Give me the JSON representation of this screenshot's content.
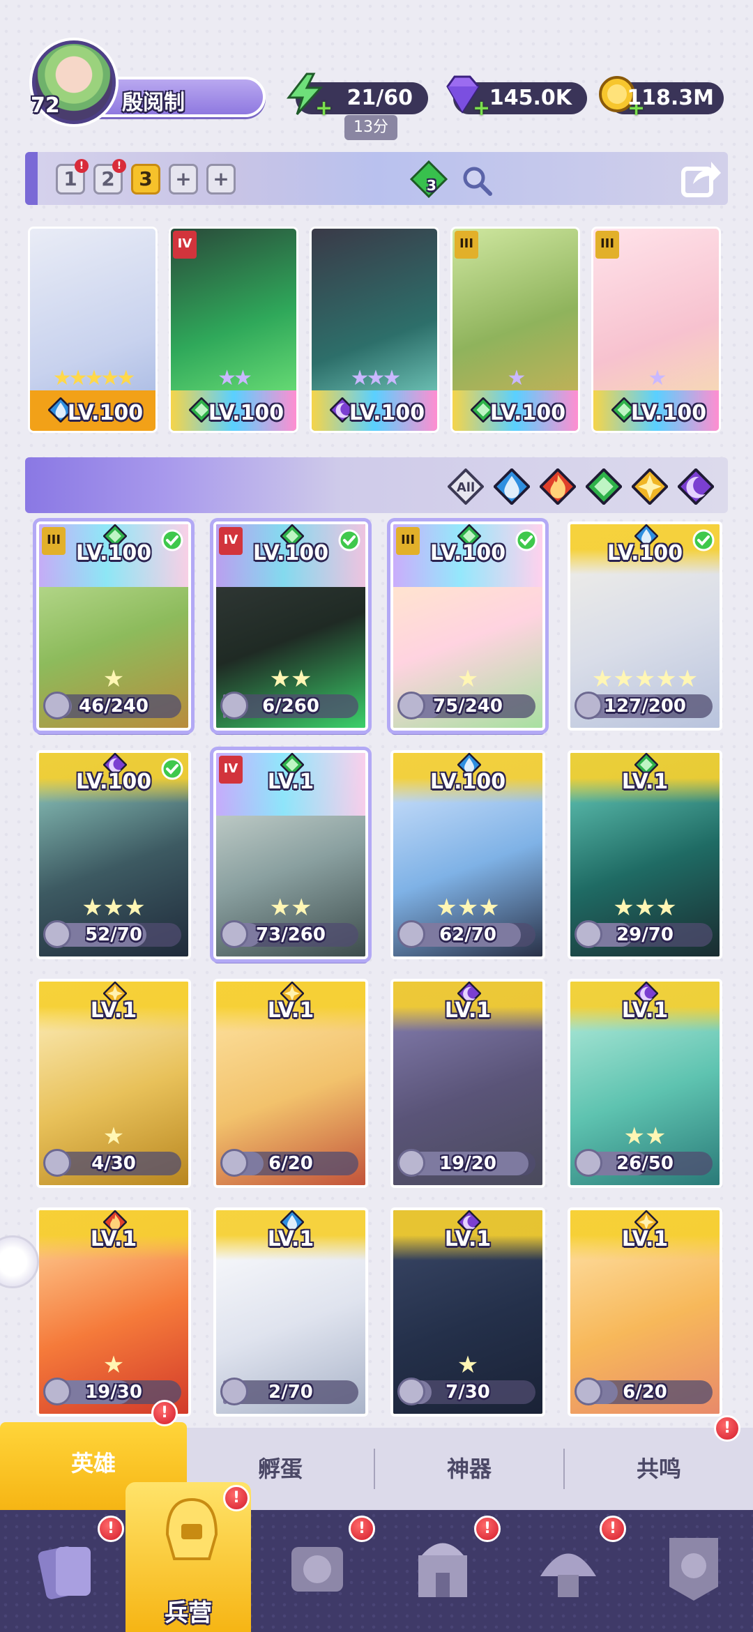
{
  "player": {
    "level": "72",
    "name": "殷阅制"
  },
  "resources": {
    "energy": {
      "value": "21/60",
      "timer": "13分",
      "icon": "lightning-bolt-icon"
    },
    "gems": {
      "value": "145.0K",
      "icon": "purple-gem-icon"
    },
    "gold": {
      "value": "118.3M",
      "icon": "gold-coin-icon"
    }
  },
  "team_bar": {
    "slots": [
      "1",
      "2",
      "3",
      "+",
      "+"
    ],
    "active_slot": "3",
    "gem_badge": "3"
  },
  "team": [
    {
      "level": "LV.100",
      "stars": "★★★★★",
      "element": "water",
      "rank": ""
    },
    {
      "level": "LV.100",
      "stars": "★★",
      "element": "nature",
      "rank": "IV"
    },
    {
      "level": "LV.100",
      "stars": "★★★",
      "element": "dark",
      "rank": ""
    },
    {
      "level": "LV.100",
      "stars": "★",
      "element": "nature",
      "rank": "III"
    },
    {
      "level": "LV.100",
      "stars": "★",
      "element": "nature",
      "rank": "III"
    }
  ],
  "filters": {
    "all_label": "All",
    "elements": [
      "water",
      "fire",
      "nature",
      "light",
      "dark"
    ]
  },
  "heroes": [
    {
      "level": "LV.100",
      "shards": "46/240",
      "progress": 0.19,
      "element": "nature",
      "rank": "III",
      "checked": true,
      "selected": true,
      "stars": "★"
    },
    {
      "level": "LV.100",
      "shards": "6/260",
      "progress": 0.02,
      "element": "nature",
      "rank": "IV",
      "checked": true,
      "selected": true,
      "stars": "★★"
    },
    {
      "level": "LV.100",
      "shards": "75/240",
      "progress": 0.31,
      "element": "nature",
      "rank": "III",
      "checked": true,
      "selected": true,
      "stars": "★"
    },
    {
      "level": "LV.100",
      "shards": "127/200",
      "progress": 0.64,
      "element": "water",
      "rank": "",
      "checked": true,
      "selected": false,
      "stars": "★★★★★"
    },
    {
      "level": "LV.100",
      "shards": "52/70",
      "progress": 0.74,
      "element": "dark",
      "rank": "",
      "checked": true,
      "selected": false,
      "stars": "★★★"
    },
    {
      "level": "LV.1",
      "shards": "73/260",
      "progress": 0.28,
      "element": "nature",
      "rank": "IV",
      "checked": false,
      "selected": true,
      "stars": "★★"
    },
    {
      "level": "LV.100",
      "shards": "62/70",
      "progress": 0.89,
      "element": "water",
      "rank": "",
      "checked": false,
      "selected": false,
      "stars": "★★★"
    },
    {
      "level": "LV.1",
      "shards": "29/70",
      "progress": 0.41,
      "element": "nature",
      "rank": "",
      "checked": false,
      "selected": false,
      "stars": "★★★"
    },
    {
      "level": "LV.1",
      "shards": "4/30",
      "progress": 0.13,
      "element": "light",
      "rank": "",
      "checked": false,
      "selected": false,
      "stars": "★"
    },
    {
      "level": "LV.1",
      "shards": "6/20",
      "progress": 0.3,
      "element": "light",
      "rank": "",
      "checked": false,
      "selected": false,
      "stars": ""
    },
    {
      "level": "LV.1",
      "shards": "19/20",
      "progress": 0.95,
      "element": "dark",
      "rank": "",
      "checked": false,
      "selected": false,
      "stars": ""
    },
    {
      "level": "LV.1",
      "shards": "26/50",
      "progress": 0.52,
      "element": "dark",
      "rank": "",
      "checked": false,
      "selected": false,
      "stars": "★★"
    },
    {
      "level": "LV.1",
      "shards": "19/30",
      "progress": 0.63,
      "element": "fire",
      "rank": "",
      "checked": false,
      "selected": false,
      "stars": "★"
    },
    {
      "level": "LV.1",
      "shards": "2/70",
      "progress": 0.03,
      "element": "water",
      "rank": "",
      "checked": false,
      "selected": false,
      "stars": ""
    },
    {
      "level": "LV.1",
      "shards": "7/30",
      "progress": 0.23,
      "element": "dark",
      "rank": "",
      "checked": false,
      "selected": false,
      "stars": "★"
    },
    {
      "level": "LV.1",
      "shards": "6/20",
      "progress": 0.3,
      "element": "light",
      "rank": "",
      "checked": false,
      "selected": false,
      "stars": ""
    }
  ],
  "subtabs": [
    {
      "label": "英雄",
      "active": true,
      "badge": "!"
    },
    {
      "label": "孵蛋",
      "active": false,
      "badge": ""
    },
    {
      "label": "神器",
      "active": false,
      "badge": ""
    },
    {
      "label": "共鸣",
      "active": false,
      "badge": "!"
    }
  ],
  "nav": [
    {
      "icon": "cards-icon",
      "label": "",
      "badge": "!"
    },
    {
      "icon": "barracks-helmet-icon",
      "label": "兵营",
      "badge": "!",
      "active": true
    },
    {
      "icon": "map-scroll-icon",
      "label": "",
      "badge": "!"
    },
    {
      "icon": "castle-icon",
      "label": "",
      "badge": "!"
    },
    {
      "icon": "mushroom-shrine-icon",
      "label": "",
      "badge": "!"
    },
    {
      "icon": "guild-banner-icon",
      "label": "",
      "badge": ""
    }
  ],
  "colors": {
    "water": "#2f8fe0",
    "fire": "#e0402a",
    "nature": "#2fb24a",
    "light": "#f0b526",
    "dark": "#7b3fd1",
    "accent": "#f6b514"
  }
}
